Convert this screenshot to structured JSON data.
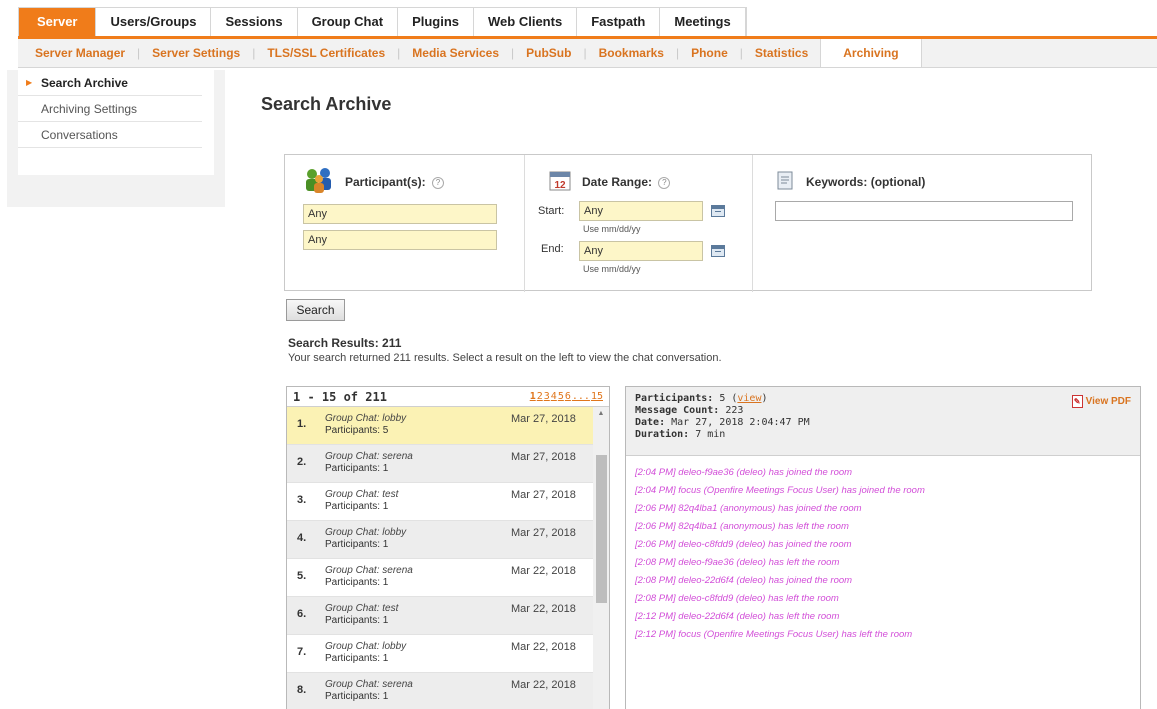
{
  "top_tabs": [
    {
      "label": "Server",
      "active": true
    },
    {
      "label": "Users/Groups"
    },
    {
      "label": "Sessions"
    },
    {
      "label": "Group Chat"
    },
    {
      "label": "Plugins"
    },
    {
      "label": "Web Clients"
    },
    {
      "label": "Fastpath"
    },
    {
      "label": "Meetings"
    }
  ],
  "sub_tabs": [
    {
      "label": "Server Manager"
    },
    {
      "label": "Server Settings"
    },
    {
      "label": "TLS/SSL Certificates"
    },
    {
      "label": "Media Services"
    },
    {
      "label": "PubSub"
    },
    {
      "label": "Bookmarks"
    },
    {
      "label": "Phone"
    },
    {
      "label": "Statistics"
    },
    {
      "label": "Archiving",
      "active": true
    }
  ],
  "sidebar": {
    "items": [
      {
        "label": "Search Archive",
        "active": true
      },
      {
        "label": "Archiving Settings"
      },
      {
        "label": "Conversations"
      }
    ]
  },
  "page_title": "Search Archive",
  "search": {
    "participants_label": "Participant(s):",
    "participant1": "Any",
    "participant2": "Any",
    "date_range_label": "Date Range:",
    "calendar_day": "12",
    "start_label": "Start:",
    "start_value": "Any",
    "end_label": "End:",
    "end_value": "Any",
    "date_hint": "Use mm/dd/yy",
    "keywords_label": "Keywords:",
    "keywords_optional": "(optional)",
    "keywords_value": "",
    "button_label": "Search"
  },
  "results": {
    "title": "Search Results: 211",
    "description": "Your search returned 211 results. Select a result on the left to view the chat conversation.",
    "range_label": "1 - 15 of 211",
    "pages": [
      "1",
      "2",
      "3",
      "4",
      "5",
      "6",
      "...",
      "15"
    ],
    "rows": [
      {
        "num": "1.",
        "room": "Group Chat: lobby",
        "participants": "Participants: 5",
        "date": "Mar 27, 2018"
      },
      {
        "num": "2.",
        "room": "Group Chat: serena",
        "participants": "Participants: 1",
        "date": "Mar 27, 2018"
      },
      {
        "num": "3.",
        "room": "Group Chat: test",
        "participants": "Participants: 1",
        "date": "Mar 27, 2018"
      },
      {
        "num": "4.",
        "room": "Group Chat: lobby",
        "participants": "Participants: 1",
        "date": "Mar 27, 2018"
      },
      {
        "num": "5.",
        "room": "Group Chat: serena",
        "participants": "Participants: 1",
        "date": "Mar 22, 2018"
      },
      {
        "num": "6.",
        "room": "Group Chat: test",
        "participants": "Participants: 1",
        "date": "Mar 22, 2018"
      },
      {
        "num": "7.",
        "room": "Group Chat: lobby",
        "participants": "Participants: 1",
        "date": "Mar 22, 2018"
      },
      {
        "num": "8.",
        "room": "Group Chat: serena",
        "participants": "Participants: 1",
        "date": "Mar 22, 2018"
      }
    ]
  },
  "conversation": {
    "participants_label": "Participants:",
    "participants_value": "5",
    "view_link": "view",
    "message_count_label": "Message Count:",
    "message_count_value": "223",
    "date_label": "Date:",
    "date_value": "Mar 27, 2018 2:04:47 PM",
    "duration_label": "Duration:",
    "duration_value": "7 min",
    "pdf_label": "View PDF",
    "messages": [
      "[2:04 PM] deleo-f9ae36 (deleo) has joined the room",
      "[2:04 PM] focus (Openfire Meetings Focus User) has joined the room",
      "[2:06 PM] 82q4lba1 (anonymous) has joined the room",
      "[2:06 PM] 82q4lba1 (anonymous) has left the room",
      "[2:06 PM] deleo-c8fdd9 (deleo) has joined the room",
      "[2:08 PM] deleo-f9ae36 (deleo) has left the room",
      "[2:08 PM] deleo-22d6f4 (deleo) has joined the room",
      "[2:08 PM] deleo-c8fdd9 (deleo) has left the room",
      "[2:12 PM] deleo-22d6f4 (deleo) has left the room",
      "[2:12 PM] focus (Openfire Meetings Focus User) has left the room"
    ]
  },
  "colors": {
    "accent": "#f07c1a",
    "message_text": "#d24ed8",
    "selected_row": "#fbf2b4",
    "input_bg": "#fdf6c8"
  }
}
